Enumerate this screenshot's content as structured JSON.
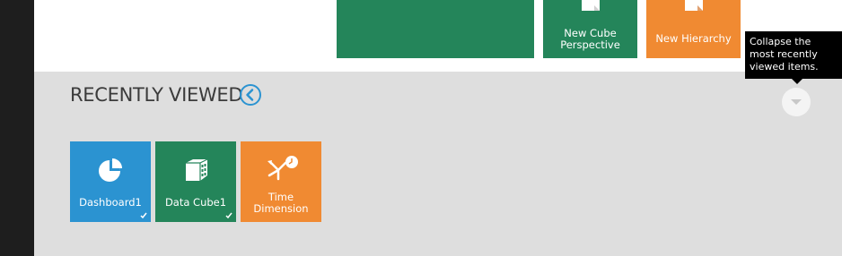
{
  "top_tiles": [
    {
      "label": ""
    },
    {
      "label": "New Cube Perspective",
      "line1": "New Cube",
      "line2": "Perspective"
    },
    {
      "label": "New Hierarchy"
    }
  ],
  "recently_viewed": {
    "title": "RECENTLY VIEWED",
    "items": [
      {
        "label": "Dashboard1",
        "icon": "pie-chart-icon",
        "color": "#2b93d1",
        "checked": true
      },
      {
        "label": "Data Cube1",
        "icon": "data-cube-icon",
        "color": "#24855a",
        "checked": true
      },
      {
        "label": "Time Dimension",
        "line1": "Time",
        "line2": "Dimension",
        "icon": "time-dimension-icon",
        "color": "#f08a32",
        "checked": false
      }
    ]
  },
  "tooltip": {
    "text": "Collapse the most recently viewed items."
  },
  "colors": {
    "green": "#24855a",
    "orange": "#f08a32",
    "blue": "#2b93d1",
    "panel_gray": "#dedede"
  }
}
